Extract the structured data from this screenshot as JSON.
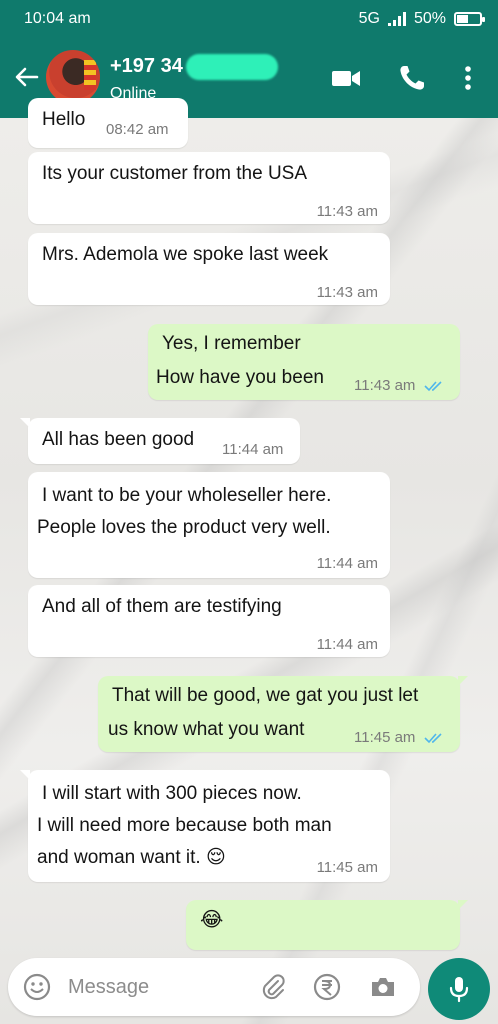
{
  "status_bar": {
    "time": "10:04 am",
    "network": "5G",
    "battery": "50%"
  },
  "header": {
    "contact_name": "+197 34",
    "contact_status": "Online",
    "icons": [
      "back-arrow-icon",
      "video-call-icon",
      "voice-call-icon",
      "more-options-icon"
    ]
  },
  "messages": [
    {
      "direction": "in",
      "text": "Hello",
      "time": "08:42 am"
    },
    {
      "direction": "in",
      "text": "Its your customer from the USA",
      "time": "11:43 am"
    },
    {
      "direction": "in",
      "text": "Mrs. Ademola we spoke last week",
      "time": "11:43 am"
    },
    {
      "direction": "out",
      "lines": [
        "Yes, I remember",
        "How have you been"
      ],
      "time": "11:43 am",
      "read": true
    },
    {
      "direction": "in",
      "text": "All has been good",
      "time": "11:44 am"
    },
    {
      "direction": "in",
      "lines": [
        "I want to be your wholeseller here.",
        "People loves the product very well."
      ],
      "time": "11:44 am"
    },
    {
      "direction": "in",
      "text": "And all of them are testifying",
      "time": "11:44 am"
    },
    {
      "direction": "out",
      "lines": [
        "That will be good, we gat you just let",
        "us know what you want"
      ],
      "time": "11:45 am",
      "read": true
    },
    {
      "direction": "in",
      "lines": [
        "I will start with 300 pieces now.",
        "I will need more because both man",
        "and woman want it. 😌"
      ],
      "time": "11:45 am"
    },
    {
      "direction": "out",
      "text": "😂",
      "time": ""
    }
  ],
  "composer": {
    "placeholder": "Message",
    "icons": [
      "emoji-icon",
      "attach-icon",
      "payment-icon",
      "camera-icon",
      "microphone-icon"
    ]
  },
  "colors": {
    "header": "#0f7a6c",
    "outgoing_bubble": "#dcf8c6",
    "incoming_bubble": "#ffffff",
    "read_tick": "#4fb6ec"
  }
}
